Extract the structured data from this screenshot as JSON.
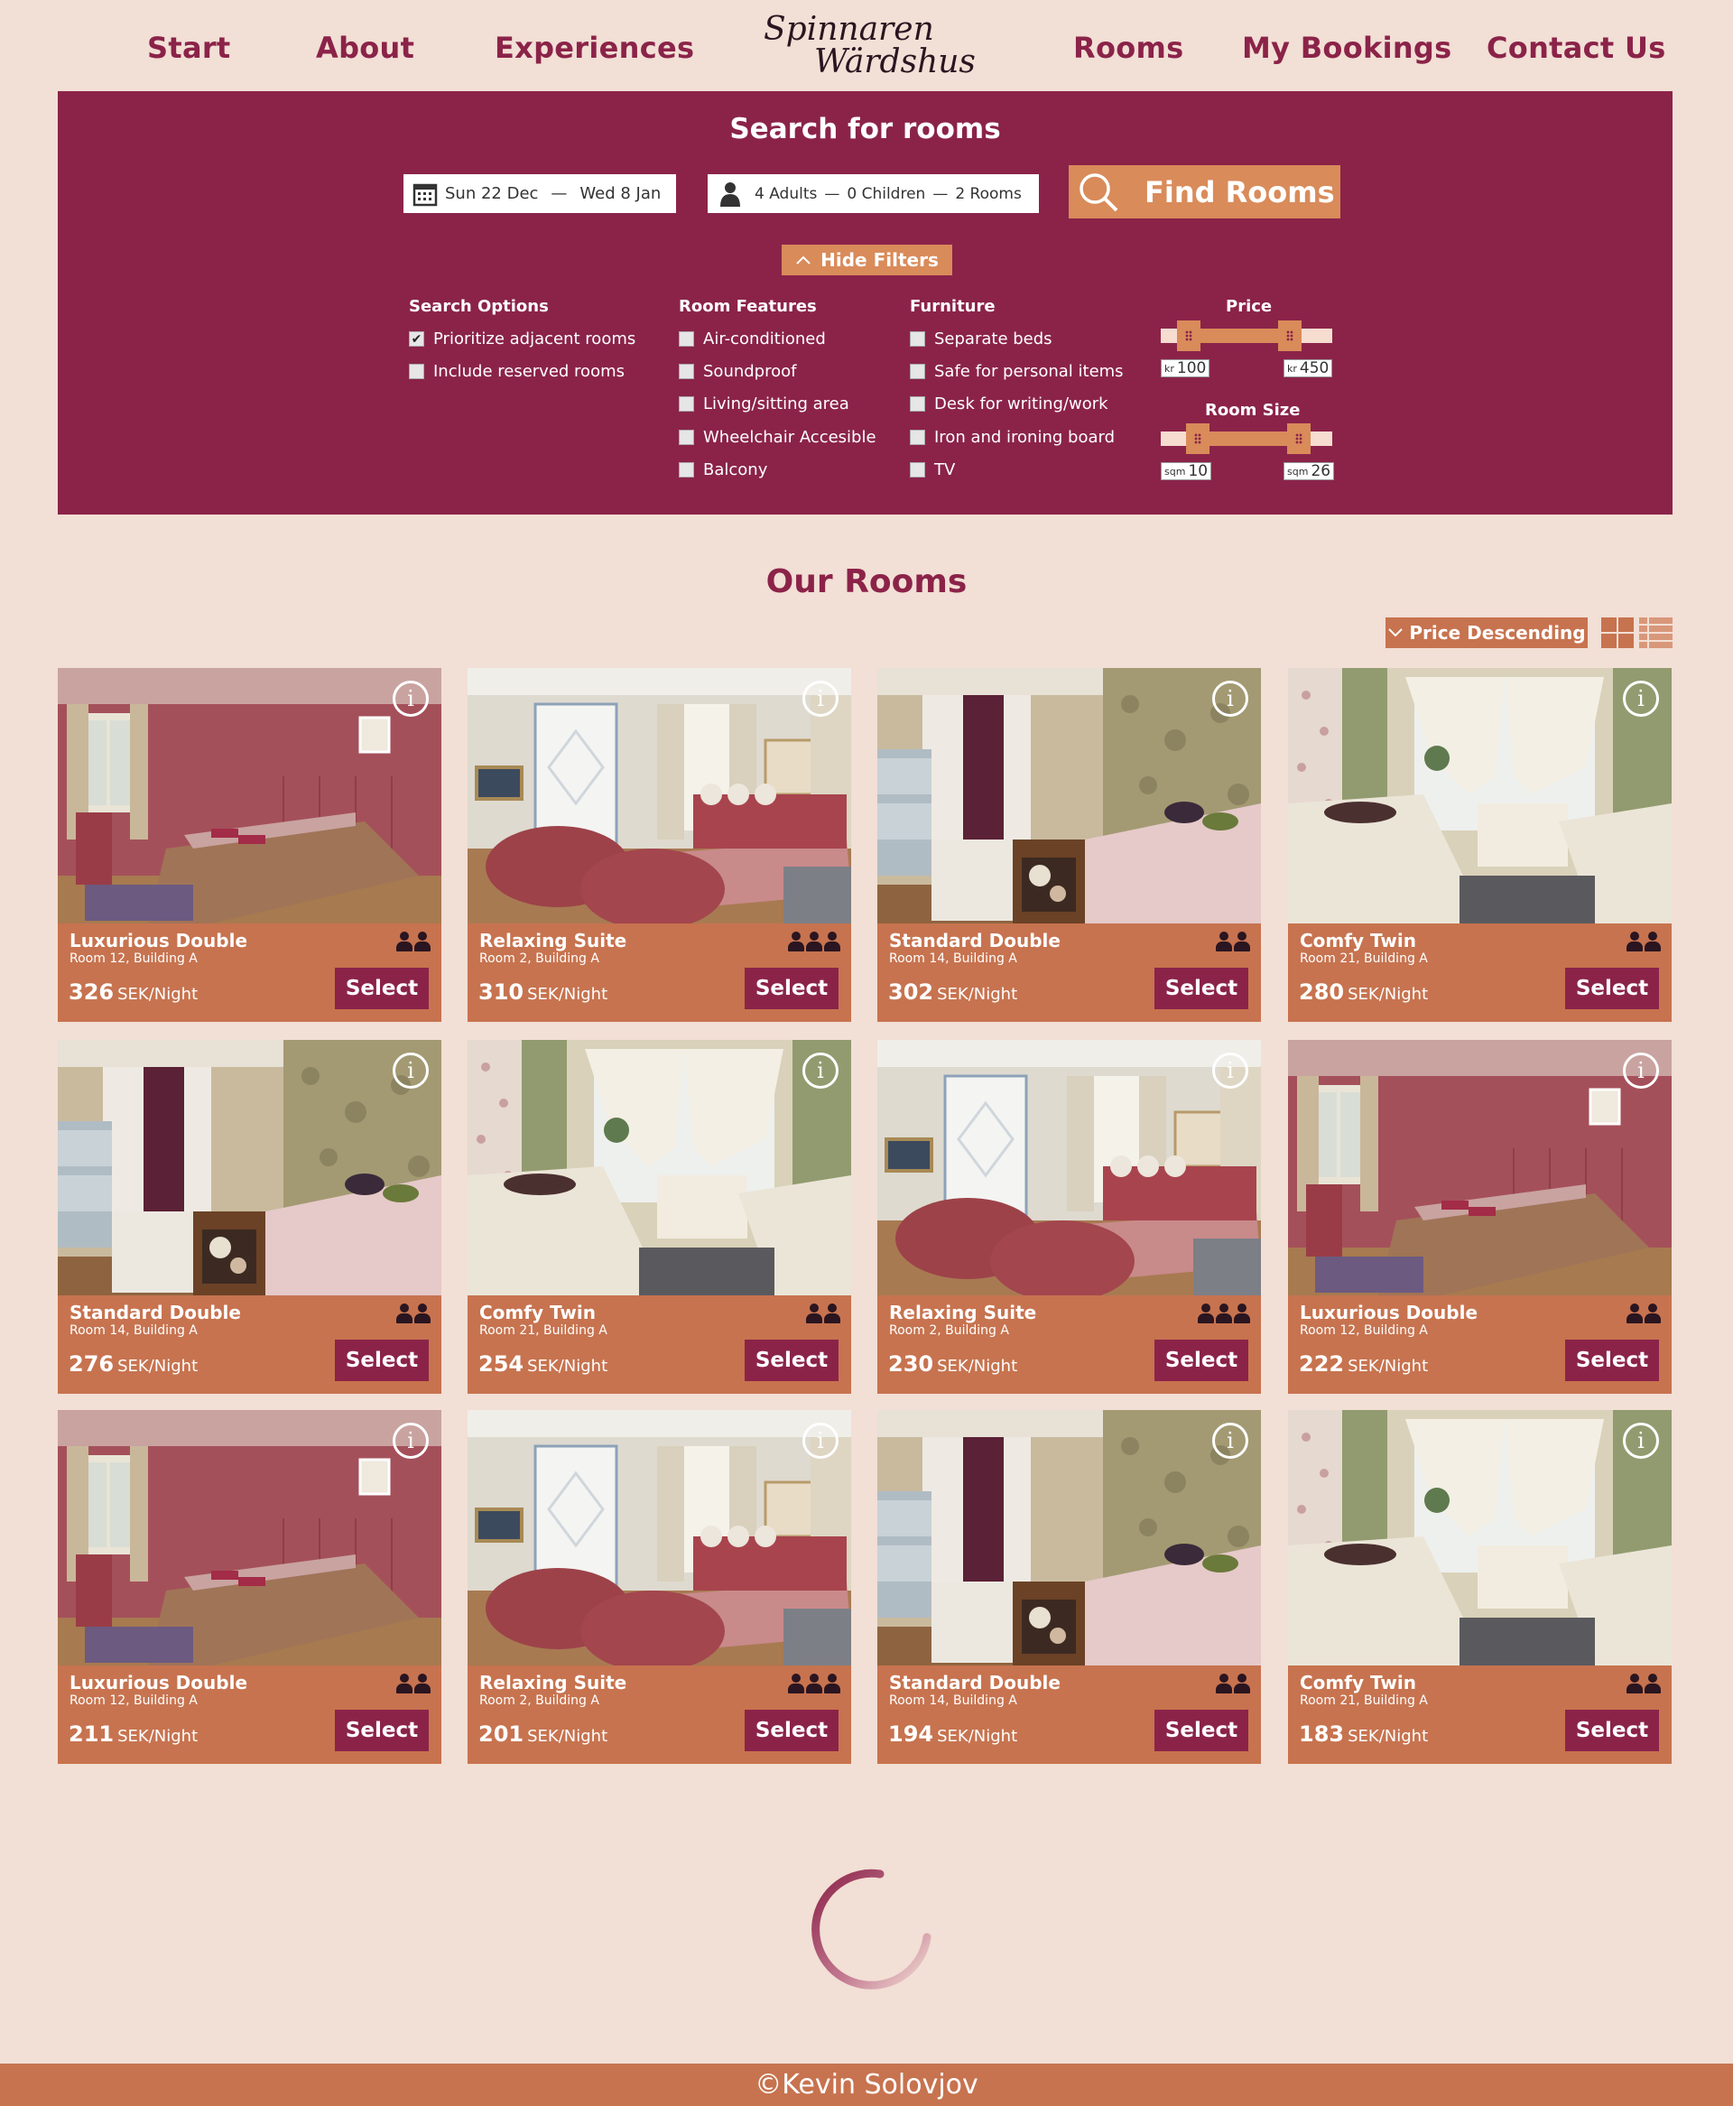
{
  "nav": {
    "start": "Start",
    "about": "About",
    "experiences": "Experiences",
    "rooms": "Rooms",
    "bookings": "My Bookings",
    "contact": "Contact Us",
    "logo_line1": "Spinnaren",
    "logo_line2": "Wärdshus"
  },
  "search": {
    "title": "Search for rooms",
    "date_from": "Sun 22 Dec",
    "date_to": "Wed 8 Jan",
    "adults": "4 Adults",
    "children": "0 Children",
    "rooms": "2 Rooms",
    "find_label": "Find Rooms",
    "hide_filters": "Hide Filters"
  },
  "filters": {
    "search_options": {
      "title": "Search Options",
      "items": [
        {
          "label": "Prioritize adjacent rooms",
          "checked": true
        },
        {
          "label": "Include reserved rooms",
          "checked": false
        }
      ]
    },
    "room_features": {
      "title": "Room Features",
      "items": [
        {
          "label": "Air-conditioned",
          "checked": false
        },
        {
          "label": "Soundproof",
          "checked": false
        },
        {
          "label": "Living/sitting area",
          "checked": false
        },
        {
          "label": "Wheelchair Accesible",
          "checked": false
        },
        {
          "label": "Balcony",
          "checked": false
        }
      ]
    },
    "furniture": {
      "title": "Furniture",
      "items": [
        {
          "label": "Separate beds",
          "checked": false
        },
        {
          "label": "Safe for personal items",
          "checked": false
        },
        {
          "label": "Desk for writing/work",
          "checked": false
        },
        {
          "label": "Iron and ironing board",
          "checked": false
        },
        {
          "label": "TV",
          "checked": false
        }
      ]
    },
    "price": {
      "title": "Price",
      "unit": "kr",
      "min": "100",
      "max": "450"
    },
    "room_size": {
      "title": "Room Size",
      "unit": "sqm",
      "min": "10",
      "max": "26"
    }
  },
  "listing": {
    "title": "Our Rooms",
    "sort_label": "Price Descending",
    "select_label": "Select",
    "per_night": "SEK/Night",
    "rooms": [
      {
        "name": "Luxurious Double",
        "location": "Room 12, Building A",
        "price": "326",
        "guests": 2,
        "photo": "red"
      },
      {
        "name": "Relaxing Suite",
        "location": "Room 2, Building A",
        "price": "310",
        "guests": 3,
        "photo": "suite"
      },
      {
        "name": "Standard Double",
        "location": "Room 14, Building A",
        "price": "302",
        "guests": 2,
        "photo": "standard"
      },
      {
        "name": "Comfy Twin",
        "location": "Room 21, Building A",
        "price": "280",
        "guests": 2,
        "photo": "twin"
      },
      {
        "name": "Standard Double",
        "location": "Room 14, Building A",
        "price": "276",
        "guests": 2,
        "photo": "standard"
      },
      {
        "name": "Comfy Twin",
        "location": "Room 21, Building A",
        "price": "254",
        "guests": 2,
        "photo": "twin"
      },
      {
        "name": "Relaxing Suite",
        "location": "Room 2, Building A",
        "price": "230",
        "guests": 3,
        "photo": "suite"
      },
      {
        "name": "Luxurious Double",
        "location": "Room 12, Building A",
        "price": "222",
        "guests": 2,
        "photo": "red"
      },
      {
        "name": "Luxurious Double",
        "location": "Room 12, Building A",
        "price": "211",
        "guests": 2,
        "photo": "red"
      },
      {
        "name": "Relaxing Suite",
        "location": "Room 2, Building A",
        "price": "201",
        "guests": 3,
        "photo": "suite"
      },
      {
        "name": "Standard Double",
        "location": "Room 14, Building A",
        "price": "194",
        "guests": 2,
        "photo": "standard"
      },
      {
        "name": "Comfy Twin",
        "location": "Room 21, Building A",
        "price": "183",
        "guests": 2,
        "photo": "twin"
      }
    ]
  },
  "footer": {
    "text": "©Kevin Solovjov"
  },
  "colors": {
    "primary": "#8b2349",
    "accent": "#d98b5a",
    "card": "#c7734f",
    "background": "#f2dfd5"
  }
}
